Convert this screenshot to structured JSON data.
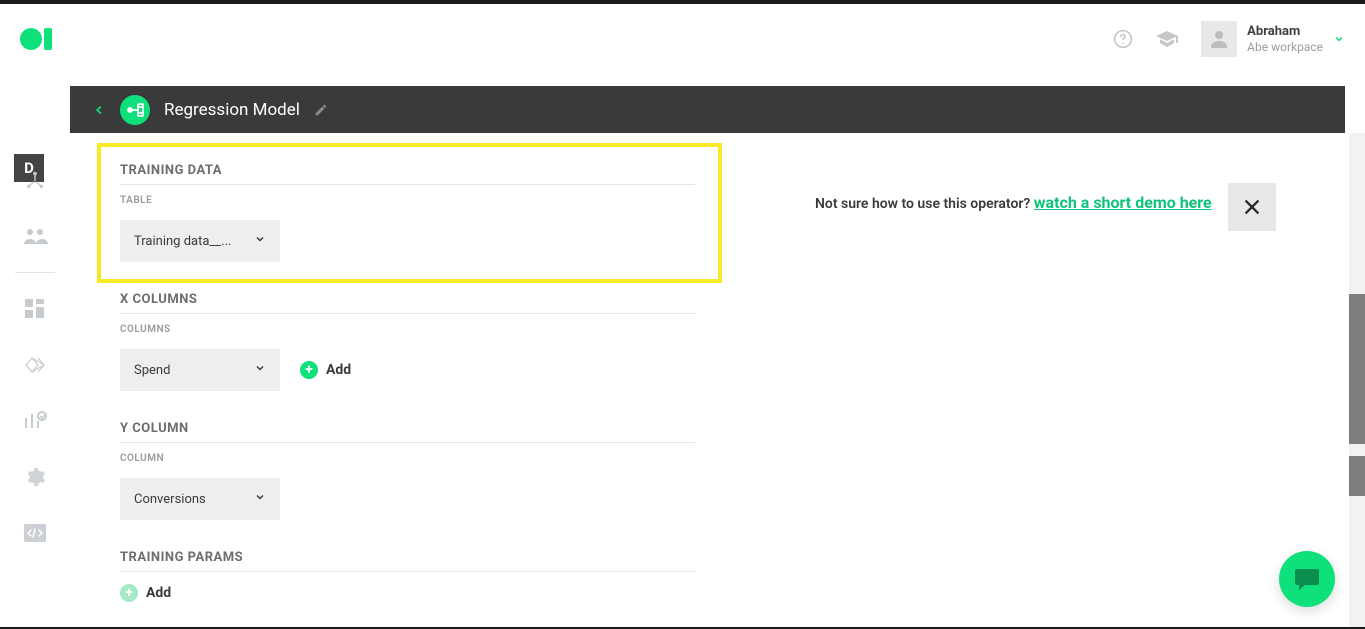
{
  "user": {
    "name": "Abraham",
    "workspace": "Abe workpace"
  },
  "sidebar": {
    "badge": "D"
  },
  "operator": {
    "title": "Regression Model"
  },
  "sections": {
    "training_data": {
      "title": "TRAINING DATA",
      "field_label": "TABLE",
      "select_value": "Training data__..."
    },
    "x_columns": {
      "title": "X COLUMNS",
      "field_label": "COLUMNS",
      "select_value": "Spend",
      "add_label": "Add"
    },
    "y_column": {
      "title": "Y COLUMN",
      "field_label": "COLUMN",
      "select_value": "Conversions"
    },
    "training_params": {
      "title": "TRAINING PARAMS",
      "add_label": "Add"
    }
  },
  "help": {
    "prefix": "Not sure how to use this operator? ",
    "link_text": "watch a short demo here"
  }
}
